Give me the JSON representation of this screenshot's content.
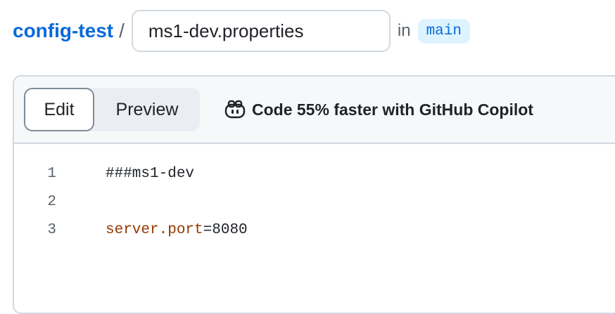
{
  "header": {
    "repo": "config-test",
    "separator": "/",
    "filename": "ms1-dev.properties",
    "in_label": "in",
    "branch": "main"
  },
  "toolbar": {
    "edit_label": "Edit",
    "preview_label": "Preview",
    "copilot_text": "Code 55% faster with GitHub Copilot",
    "copilot_icon": "copilot-icon"
  },
  "code": {
    "lines": [
      {
        "number": "1",
        "text": "###ms1-dev"
      },
      {
        "number": "2",
        "text": ""
      },
      {
        "number": "3",
        "key": "server.port",
        "op": "=",
        "value": "8080"
      }
    ]
  },
  "colors": {
    "link": "#0969da",
    "branch_bg": "#ddf4ff",
    "property_key": "#953800"
  }
}
